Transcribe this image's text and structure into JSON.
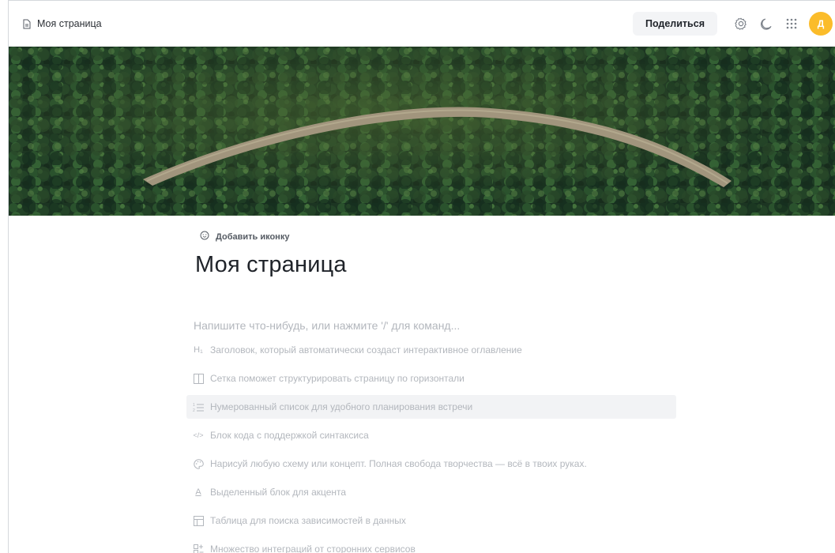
{
  "header": {
    "breadcrumb_title": "Моя страница",
    "share_label": "Поделиться",
    "avatar_initial": "Д",
    "avatar_color": "#fbbc2a"
  },
  "page": {
    "add_icon_label": "Добавить иконку",
    "title": "Моя страница",
    "placeholder": "Напишите что-нибудь, или нажмите '/' для команд..."
  },
  "suggestions": [
    {
      "icon": "heading-icon",
      "glyph": "H₁",
      "label": "Заголовок, который автоматически создаст интерактивное оглавление"
    },
    {
      "icon": "grid-columns-icon",
      "label": "Сетка поможет структурировать страницу по горизонтали"
    },
    {
      "icon": "numbered-list-icon",
      "label": "Нумерованный список для удобного планирования встречи",
      "highlighted": true
    },
    {
      "icon": "code-icon",
      "glyph": "</>",
      "label": "Блок кода с поддержкой синтаксиса"
    },
    {
      "icon": "palette-icon",
      "label": "Нарисуй любую схему или концепт. Полная свобода творчества — всё в твоих руках."
    },
    {
      "icon": "highlight-icon",
      "glyph": "A",
      "label": "Выделенный блок для акцента"
    },
    {
      "icon": "table-icon",
      "label": "Таблица для поиска зависимостей в данных"
    },
    {
      "icon": "integrations-icon",
      "label": "Множество интеграций от сторонних сервисов"
    }
  ]
}
